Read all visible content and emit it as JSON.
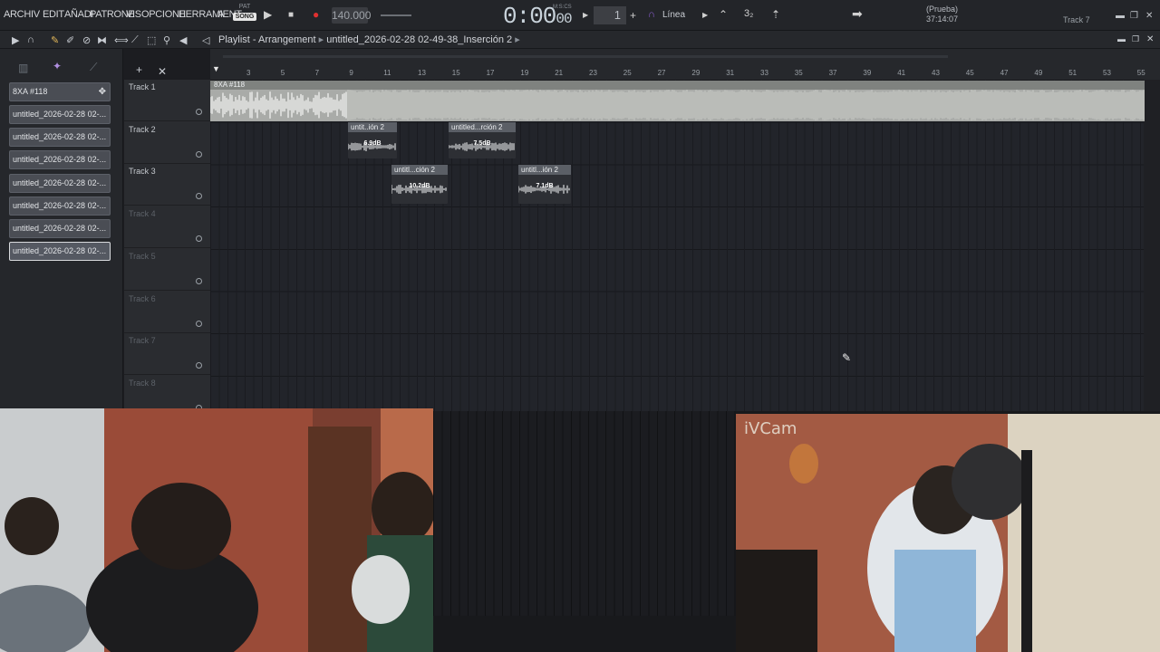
{
  "menu": {
    "items": [
      "ARCHIV",
      "EDIT",
      "AÑADI",
      "PATRONE",
      "VIS",
      "OPCIONE",
      "HERRAMIENT",
      "A"
    ]
  },
  "transport": {
    "pat": "PAT",
    "song": "SONG",
    "tempo": "140.000",
    "time": "0:00",
    "time_frac": "00",
    "time_unit": "M:S:CS",
    "pattern": "1",
    "snap": "Línea"
  },
  "hint": {
    "line1": "(Prueba)",
    "line2": "37:14:07",
    "track": "Track 7"
  },
  "playlist": {
    "title": "Playlist - Arrangement",
    "file": "untitled_2026-02-28 02-49-38_Inserción 2"
  },
  "clips_panel": [
    {
      "label": "8XA #118"
    },
    {
      "label": "untitled_2026-02-28 02-..."
    },
    {
      "label": "untitled_2026-02-28 02-..."
    },
    {
      "label": "untitled_2026-02-28 02-..."
    },
    {
      "label": "untitled_2026-02-28 02-..."
    },
    {
      "label": "untitled_2026-02-28 02-..."
    },
    {
      "label": "untitled_2026-02-28 02-..."
    },
    {
      "label": "untitled_2026-02-28 02-..."
    }
  ],
  "tracks": [
    "Track 1",
    "Track 2",
    "Track 3",
    "Track 4",
    "Track 5",
    "Track 6",
    "Track 7",
    "Track 8"
  ],
  "ruler": [
    "3",
    "5",
    "7",
    "9",
    "11",
    "13",
    "15",
    "17",
    "19",
    "21",
    "23",
    "25",
    "27",
    "29",
    "31",
    "33",
    "35",
    "37",
    "39",
    "41",
    "43",
    "45",
    "47",
    "49",
    "51",
    "53",
    "55"
  ],
  "audio_clips": [
    {
      "name": "8XA #118"
    },
    {
      "name": "untit..ión 2",
      "db": "6.9dB"
    },
    {
      "name": "untitled...rción 2",
      "db": "7.5dB"
    },
    {
      "name": "untitl...ción 2",
      "db": "10.2dB"
    },
    {
      "name": "untitl...ión 2",
      "db": "7.1dB"
    }
  ],
  "webcam2": {
    "watermark": "iVCam"
  },
  "colors": {
    "accent": "#e03030",
    "bg": "#1c1d21",
    "clip": "#a9aba8"
  }
}
